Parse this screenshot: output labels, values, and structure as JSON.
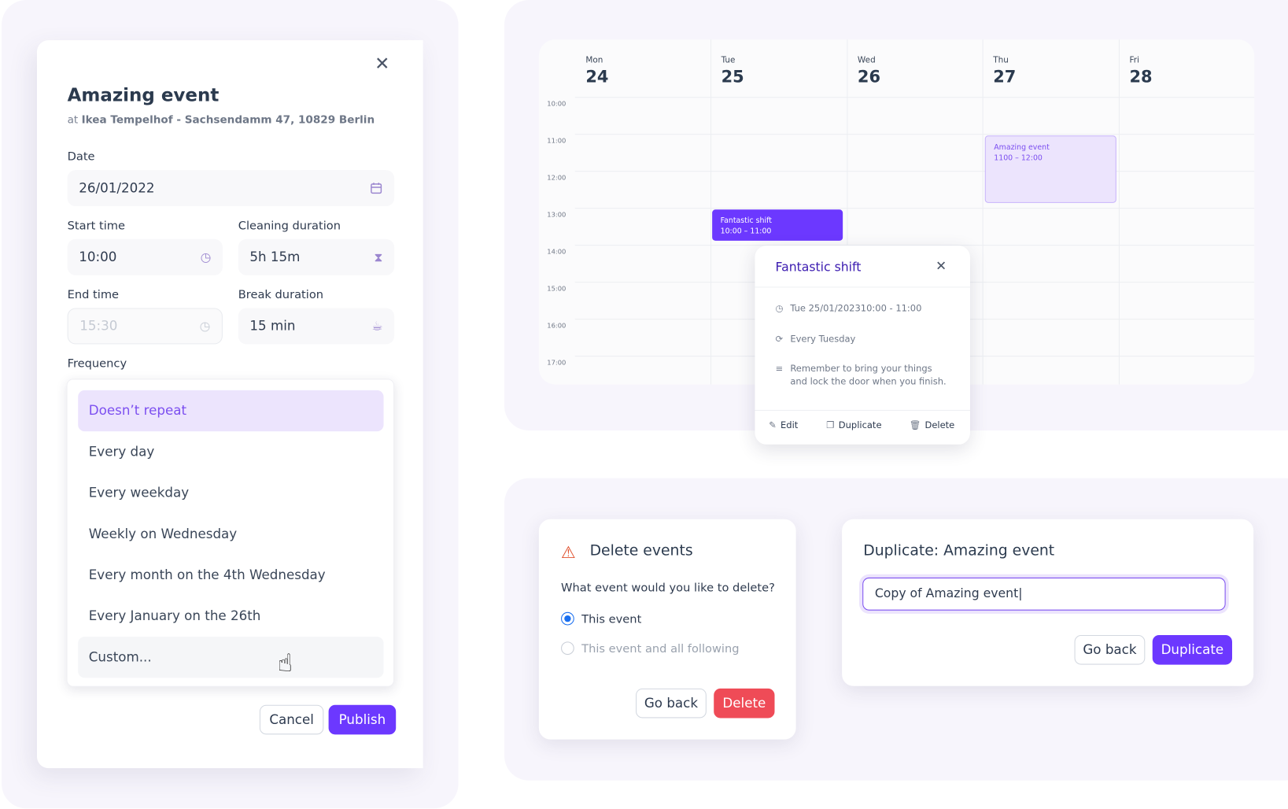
{
  "event_form": {
    "title": "Amazing event",
    "location_prefix": "at",
    "location": "Ikea Tempelhof - Sachsendamm 47, 10829 Berlin",
    "close_icon": "close-icon",
    "date": {
      "label": "Date",
      "value": "26/01/2022",
      "icon": "calendar-icon"
    },
    "start_time": {
      "label": "Start time",
      "value": "10:00",
      "icon": "clock-icon"
    },
    "cleaning_duration": {
      "label": "Cleaning duration",
      "value": "5h 15m",
      "icon": "hourglass-icon"
    },
    "end_time": {
      "label": "End time",
      "value": "15:30",
      "icon": "clock-icon",
      "disabled": true
    },
    "break_duration": {
      "label": "Break duration",
      "value": "15 min",
      "icon": "coffee-cup-icon"
    },
    "frequency": {
      "label": "Frequency",
      "selected": "Doesn’t repeat",
      "options": [
        "Doesn’t repeat",
        "Every day",
        "Every weekday",
        "Weekly on Wednesday",
        "Every month on the 4th Wednesday",
        "Every January on the 26th",
        "Custom..."
      ],
      "hovered": "Custom..."
    },
    "cancel_label": "Cancel",
    "publish_label": "Publish"
  },
  "calendar": {
    "days": [
      {
        "name": "Mon",
        "num": "24"
      },
      {
        "name": "Tue",
        "num": "25"
      },
      {
        "name": "Wed",
        "num": "26"
      },
      {
        "name": "Thu",
        "num": "27"
      },
      {
        "name": "Fri",
        "num": "28"
      }
    ],
    "times": [
      "10:00",
      "11:00",
      "12:00",
      "13:00",
      "14:00",
      "15:00",
      "16:00",
      "17:00"
    ],
    "events": [
      {
        "title": "Fantastic shift",
        "time": "10:00 – 11:00",
        "day": "Tue"
      },
      {
        "title": "Amazing event",
        "time": "1100 – 12:00",
        "day": "Thu"
      }
    ]
  },
  "popover": {
    "title": "Fantastic shift",
    "datetime": "Tue 25/01/202310:00 - 11:00",
    "recurrence": "Every Tuesday",
    "note_line1": "Remember to bring your things",
    "note_line2": "and lock the door when you finish.",
    "edit_label": "Edit",
    "duplicate_label": "Duplicate",
    "delete_label": "Delete"
  },
  "delete_dialog": {
    "title": "Delete events",
    "question": "What event would you like to delete?",
    "options": [
      "This event",
      "This event and all following"
    ],
    "selected": "This event",
    "go_back_label": "Go back",
    "delete_label": "Delete",
    "colors": {
      "danger": "#ef4b57",
      "radio": "#1a6ff0"
    }
  },
  "duplicate_dialog": {
    "title": "Duplicate: Amazing event",
    "input_value": "Copy of Amazing event|",
    "go_back_label": "Go back",
    "duplicate_label": "Duplicate"
  },
  "colors": {
    "primary": "#6c38ff",
    "primary_light": "#ece4fd",
    "text": "#2d3a4f"
  }
}
